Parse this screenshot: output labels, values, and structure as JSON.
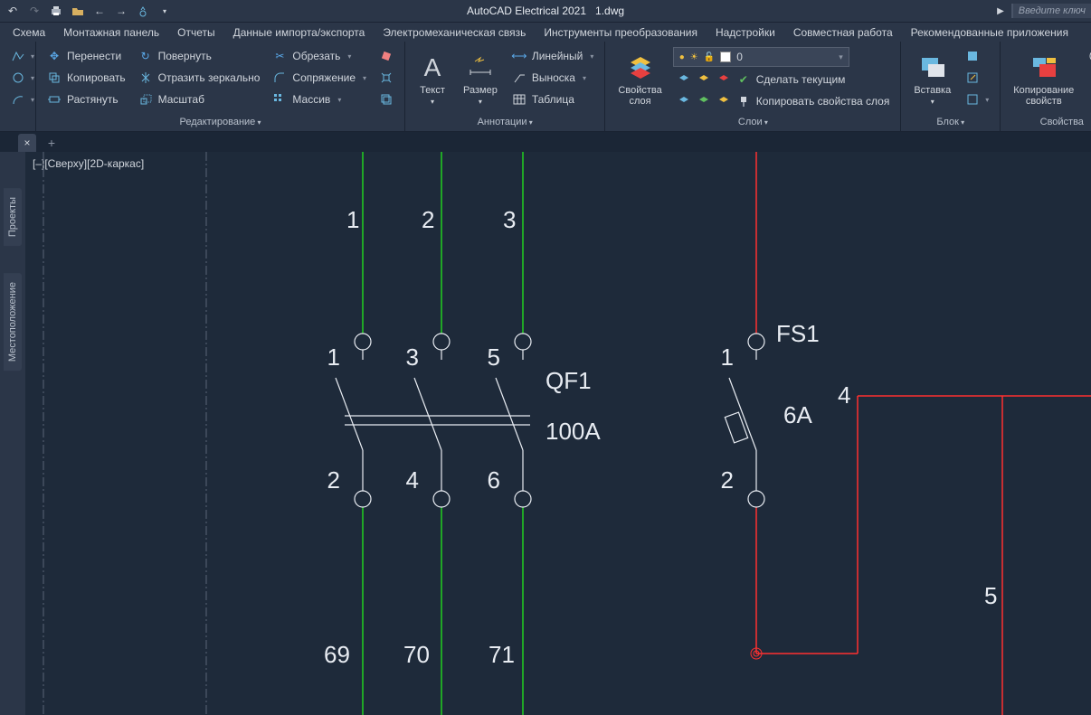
{
  "title": {
    "app": "AutoCAD Electrical 2021",
    "file": "1.dwg",
    "search_placeholder": "Введите ключ"
  },
  "menu": [
    "Схема",
    "Монтажная панель",
    "Отчеты",
    "Данные импорта/экспорта",
    "Электромеханическая связь",
    "Инструменты преобразования",
    "Надстройки",
    "Совместная работа",
    "Рекомендованные приложения"
  ],
  "ribbon": {
    "edit": {
      "title": "Редактирование",
      "move": "Перенести",
      "copy": "Копировать",
      "stretch": "Растянуть",
      "rotate": "Повернуть",
      "mirror": "Отразить зеркально",
      "scale": "Масштаб",
      "trim": "Обрезать",
      "fillet": "Сопряжение",
      "array": "Массив"
    },
    "annot": {
      "title": "Аннотации",
      "text": "Текст",
      "dim": "Размер",
      "linear": "Линейный",
      "leader": "Выноска",
      "table": "Таблица"
    },
    "layers": {
      "title": "Слои",
      "props": "Свойства\nслоя",
      "current": "0",
      "make_current": "Сделать текущим",
      "copy_props": "Копировать свойства слоя"
    },
    "block": {
      "title": "Блок",
      "insert": "Вставка"
    },
    "props": {
      "title": "Свойства",
      "copy": "Копирование\nсвойств"
    }
  },
  "side": {
    "projects": "Проекты",
    "location": "Местоположение"
  },
  "view": {
    "label": "[–][Сверху][2D-каркас]"
  },
  "schematic": {
    "wire_top": [
      "1",
      "2",
      "3"
    ],
    "qf_top": [
      "1",
      "3",
      "5"
    ],
    "qf_bot": [
      "2",
      "4",
      "6"
    ],
    "qf_label": "QF1",
    "qf_rating": "100A",
    "fs_label": "FS1",
    "fs_rating": "6A",
    "fs_top": "1",
    "fs_top_r": "4",
    "fs_bot": "2",
    "wire_bot": [
      "69",
      "70",
      "71"
    ],
    "right_num": "5"
  }
}
